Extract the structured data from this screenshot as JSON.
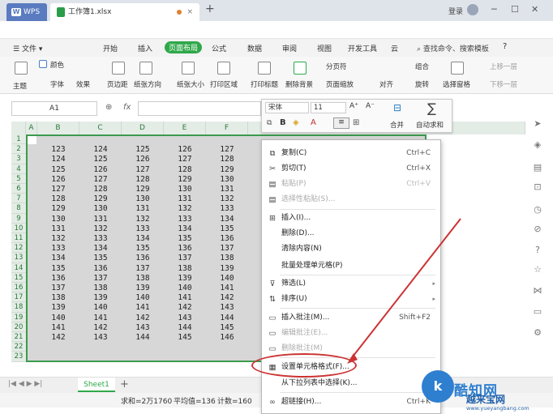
{
  "titlebar": {
    "app_tab": "WPS",
    "doc_tab": "工作簿1.xlsx",
    "login": "登录"
  },
  "menubar": {
    "file_label": "文件",
    "tabs": [
      "开始",
      "插入",
      "页面布局",
      "公式",
      "数据",
      "审阅",
      "视图",
      "开发工具",
      "云"
    ],
    "active_tab": "页面布局",
    "search_label": "查找命令、搜索模板",
    "help": "?"
  },
  "ribbon": {
    "theme": "主题",
    "color": "颜色",
    "font": "字体",
    "effect": "效果",
    "margins": "页边距",
    "orientation": "纸张方向",
    "size": "纸张大小",
    "print_area": "打印区域",
    "print_titles": "打印标题",
    "delete_bg": "删除背景",
    "page_break": "分页符",
    "page_zoom": "页面缩放",
    "align": "对齐",
    "group": "组合",
    "rotate": "旋转",
    "select_pane": "选择窗格",
    "bring_forward": "上移一层",
    "send_backward": "下移一层"
  },
  "formula_bar": {
    "cell_ref": "A1",
    "fx": "fx"
  },
  "grid": {
    "columns": [
      "A",
      "B",
      "C",
      "D",
      "E",
      "F"
    ],
    "rows": [
      "1",
      "2",
      "3",
      "4",
      "5",
      "6",
      "7",
      "8",
      "9",
      "10",
      "11",
      "12",
      "13",
      "14",
      "15",
      "16",
      "17",
      "18",
      "19",
      "20",
      "21",
      "22",
      "23"
    ],
    "data": [
      [
        "123",
        "124",
        "125",
        "126",
        "127"
      ],
      [
        "124",
        "125",
        "126",
        "127",
        "128"
      ],
      [
        "125",
        "126",
        "127",
        "128",
        "129"
      ],
      [
        "126",
        "127",
        "128",
        "129",
        "130"
      ],
      [
        "127",
        "128",
        "129",
        "130",
        "131"
      ],
      [
        "128",
        "129",
        "130",
        "131",
        "132"
      ],
      [
        "129",
        "130",
        "131",
        "132",
        "133"
      ],
      [
        "130",
        "131",
        "132",
        "133",
        "134"
      ],
      [
        "131",
        "132",
        "133",
        "134",
        "135"
      ],
      [
        "132",
        "133",
        "134",
        "135",
        "136"
      ],
      [
        "133",
        "134",
        "135",
        "136",
        "137"
      ],
      [
        "134",
        "135",
        "136",
        "137",
        "138"
      ],
      [
        "135",
        "136",
        "137",
        "138",
        "139"
      ],
      [
        "136",
        "137",
        "138",
        "139",
        "140"
      ],
      [
        "137",
        "138",
        "139",
        "140",
        "141"
      ],
      [
        "138",
        "139",
        "140",
        "141",
        "142"
      ],
      [
        "139",
        "140",
        "141",
        "142",
        "143"
      ],
      [
        "140",
        "141",
        "142",
        "143",
        "144"
      ],
      [
        "141",
        "142",
        "143",
        "144",
        "145"
      ],
      [
        "142",
        "143",
        "144",
        "145",
        "146"
      ]
    ]
  },
  "mini_toolbar": {
    "font_name": "宋体",
    "font_size": "11",
    "bold": "B",
    "merge": "合并",
    "autosum": "自动求和"
  },
  "context_menu": {
    "items": [
      {
        "label": "复制(C)",
        "shortcut": "Ctrl+C",
        "disabled": false
      },
      {
        "label": "剪切(T)",
        "shortcut": "Ctrl+X",
        "disabled": false
      },
      {
        "label": "粘贴(P)",
        "shortcut": "Ctrl+V",
        "disabled": true
      },
      {
        "label": "选择性粘贴(S)...",
        "shortcut": "",
        "disabled": true
      },
      {
        "label": "插入(I)...",
        "shortcut": "",
        "disabled": false
      },
      {
        "label": "删除(D)...",
        "shortcut": "",
        "disabled": false
      },
      {
        "label": "清除内容(N)",
        "shortcut": "",
        "disabled": false
      },
      {
        "label": "批量处理单元格(P)",
        "shortcut": "",
        "disabled": false
      },
      {
        "label": "筛选(L)",
        "shortcut": "",
        "disabled": false
      },
      {
        "label": "排序(U)",
        "shortcut": "",
        "disabled": false
      },
      {
        "label": "插入批注(M)...",
        "shortcut": "Shift+F2",
        "disabled": false
      },
      {
        "label": "编辑批注(E)...",
        "shortcut": "",
        "disabled": true
      },
      {
        "label": "删除批注(M)",
        "shortcut": "",
        "disabled": true
      },
      {
        "label": "设置单元格格式(F)...",
        "shortcut": "",
        "disabled": false
      },
      {
        "label": "从下拉列表中选择(K)...",
        "shortcut": "",
        "disabled": false
      },
      {
        "label": "超链接(H)...",
        "shortcut": "Ctrl+K",
        "disabled": false
      }
    ]
  },
  "sheet_bar": {
    "sheet_name": "Sheet1"
  },
  "status_bar": {
    "sum": "求和=2万1760",
    "average": "平均值=136",
    "count": "计数=160"
  },
  "watermark": {
    "logo": "k",
    "brand": "酷知网",
    "site_name": "越来宝网",
    "url": "www.yueyangbang.com"
  },
  "colors": {
    "accent_green": "#2fa84a",
    "selection_border": "#3b9a4e",
    "highlight_red": "#cc3333"
  }
}
